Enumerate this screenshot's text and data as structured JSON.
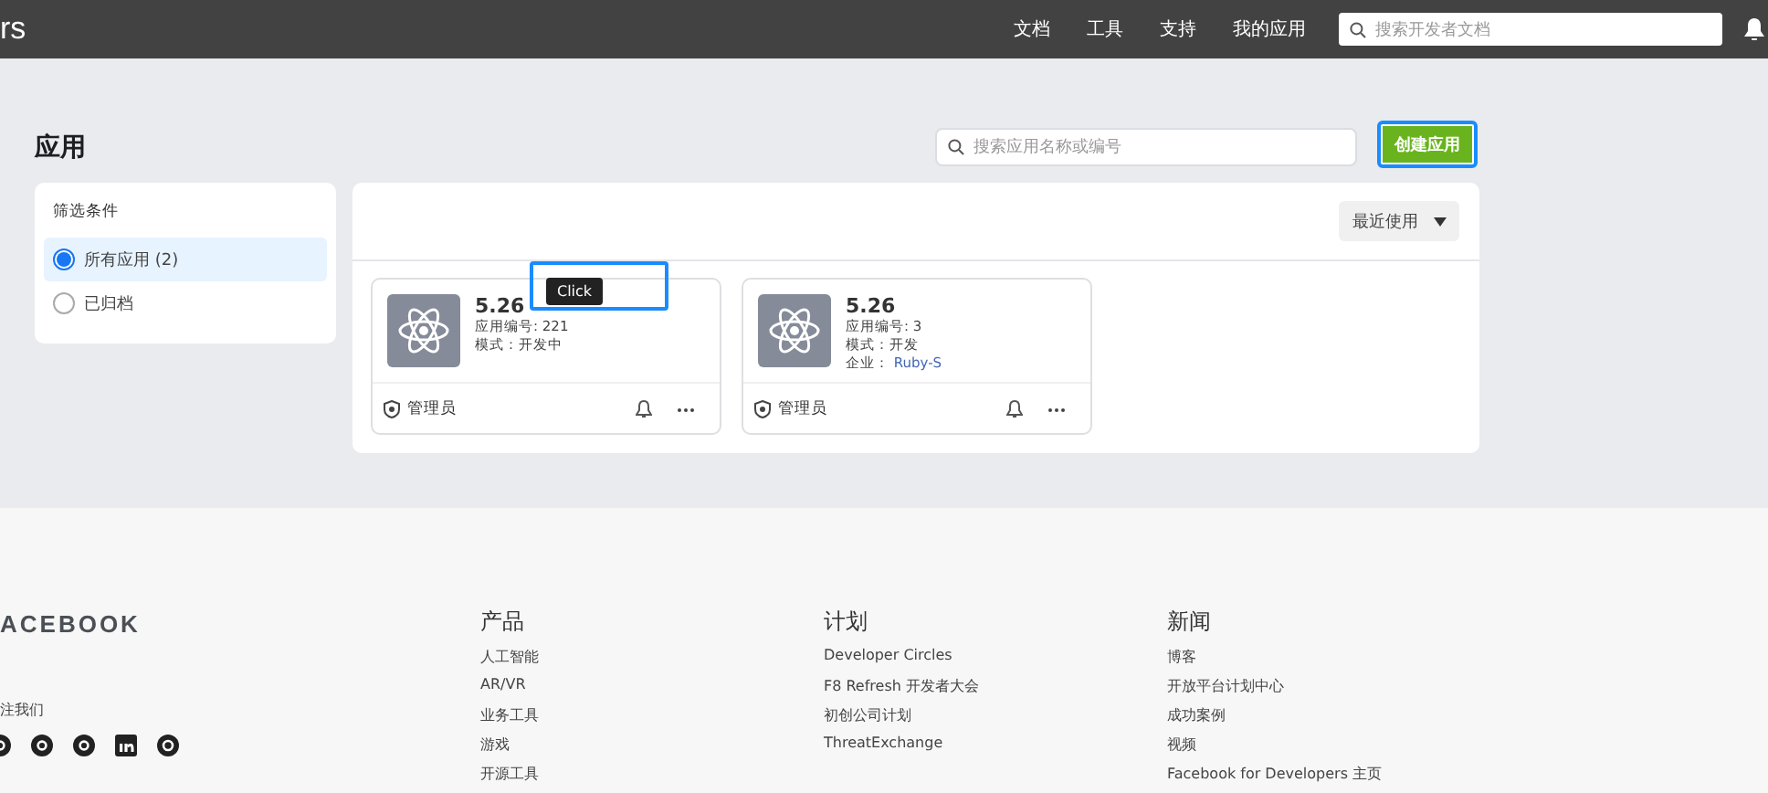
{
  "topbar": {
    "brand": "rs",
    "nav": [
      "文档",
      "工具",
      "支持",
      "我的应用"
    ],
    "search": {
      "placeholder": "搜索开发者文档"
    }
  },
  "page": {
    "title": "应用",
    "search": {
      "placeholder": "搜索应用名称或编号"
    },
    "create_button": "创建应用"
  },
  "filter": {
    "title": "筛选条件",
    "options": [
      {
        "label": "所有应用 (2)",
        "selected": true
      },
      {
        "label": "已归档",
        "selected": false
      }
    ]
  },
  "sort": {
    "label": "最近使用"
  },
  "apps": [
    {
      "name": "5.26",
      "lines": [
        {
          "kind": "plain",
          "text": "应用编号: 221"
        },
        {
          "kind": "plain",
          "text": "模式：开发中"
        }
      ],
      "role": "管理员"
    },
    {
      "name": "5.26",
      "lines": [
        {
          "kind": "plain",
          "text": "应用编号: 3"
        },
        {
          "kind": "plain",
          "text": "模式：开发"
        },
        {
          "kind": "link",
          "label": "企业：",
          "value": "Ruby-S"
        }
      ],
      "role": "管理员"
    }
  ],
  "tooltip": "Click",
  "footer": {
    "brand": "ACEBOOK",
    "follow": "注我们",
    "columns": [
      {
        "title": "产品",
        "links": [
          "人工智能",
          "AR/VR",
          "业务工具",
          "游戏",
          "开源工具"
        ]
      },
      {
        "title": "计划",
        "links": [
          "Developer Circles",
          "F8 Refresh 开发者大会",
          "初创公司计划",
          "ThreatExchange"
        ]
      },
      {
        "title": "新闻",
        "links": [
          "博客",
          "开放平台计划中心",
          "成功案例",
          "视频",
          "Facebook for Developers 主页"
        ]
      }
    ]
  }
}
